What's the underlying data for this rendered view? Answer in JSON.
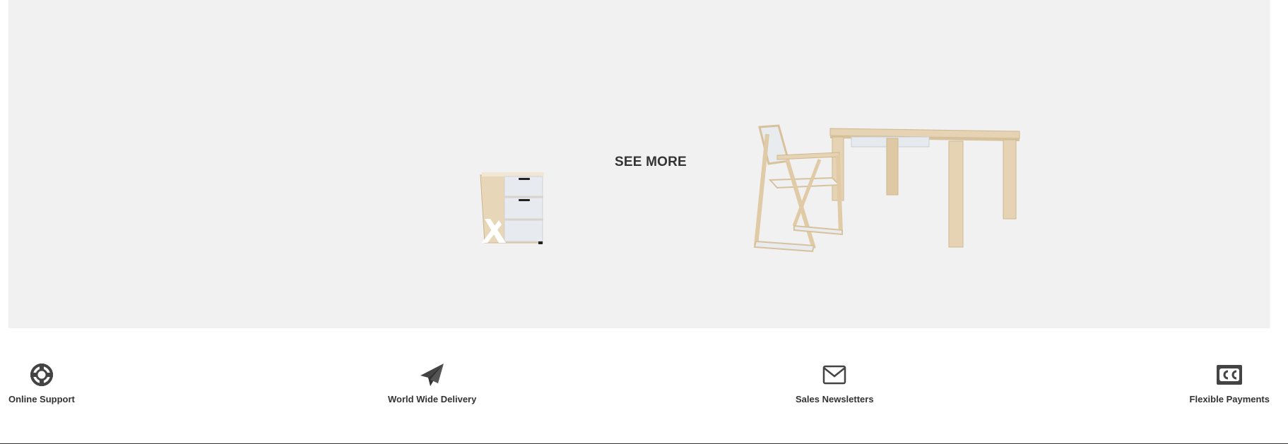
{
  "banner": {
    "cta_label": "SEE MORE"
  },
  "features": {
    "items": [
      {
        "label": "Online Support",
        "icon": "lifebuoy-icon"
      },
      {
        "label": "World Wide Delivery",
        "icon": "paper-plane-icon"
      },
      {
        "label": "Sales Newsletters",
        "icon": "envelope-icon"
      },
      {
        "label": "Flexible Payments",
        "icon": "credit-card-icon"
      }
    ]
  },
  "colors": {
    "banner_bg": "#f1f1f1",
    "text": "#333333",
    "wood": "#e6d3b3",
    "white_panel": "#e9ecef"
  }
}
